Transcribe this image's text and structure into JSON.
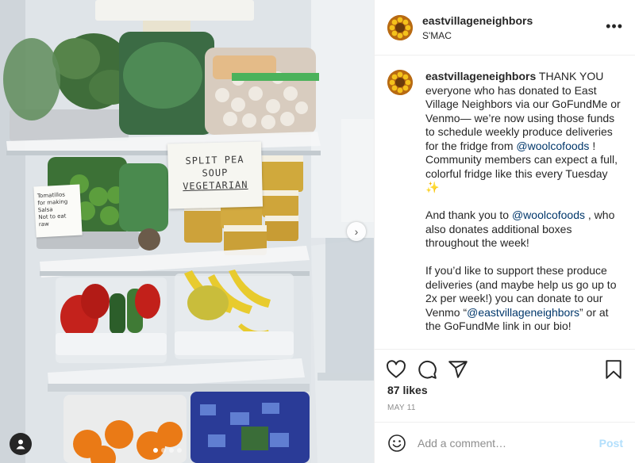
{
  "post": {
    "account": {
      "username": "eastvillageneighbors",
      "location": "S'MAC"
    },
    "photo": {
      "note_label_lines": [
        "SPLIT PEA",
        "SOUP",
        "VEGETARIAN"
      ],
      "tomatillo_label_lines": [
        "Tomatillos",
        "for making",
        "Salsa",
        "Not to eat",
        "raw"
      ],
      "carousel_dot_count": 4,
      "carousel_active_index": 0
    },
    "caption": {
      "username": "eastvillageneighbors",
      "p1_a": " THANK YOU everyone who has donated to East Village Neighbors via our GoFundMe or Venmo— we’re now using those funds to schedule weekly produce deliveries for the fridge from ",
      "p1_mention": "@woolcofoods",
      "p1_b": " ! Community members can expect a full, colorful fridge like this every Tuesday ✨",
      "p2_a": "And thank you to ",
      "p2_mention": "@woolcofoods",
      "p2_b": " , who also donates additional boxes throughout the week!",
      "p3_a": "If you’d like to support these produce deliveries (and maybe help us go up to 2x per week!) you can donate to our Venmo “",
      "p3_mention": "@eastvillageneighbors",
      "p3_b": "” or at the GoFundMe link in our bio!"
    },
    "likes": "87 likes",
    "date": "MAY 11",
    "comment": {
      "placeholder": "Add a comment…",
      "value": "",
      "post_label": "Post"
    },
    "icons": [
      "more-options-icon",
      "heart-icon",
      "comment-icon",
      "share-icon",
      "bookmark-icon",
      "emoji-icon",
      "tag-user-icon",
      "next-arrow-icon"
    ],
    "colors": {
      "mention": "#00376b",
      "post_disabled": "#b2dffc",
      "muted": "#8e8e8e",
      "avatar_orange": "#b86a12",
      "avatar_yellow": "#f4c21b"
    }
  }
}
